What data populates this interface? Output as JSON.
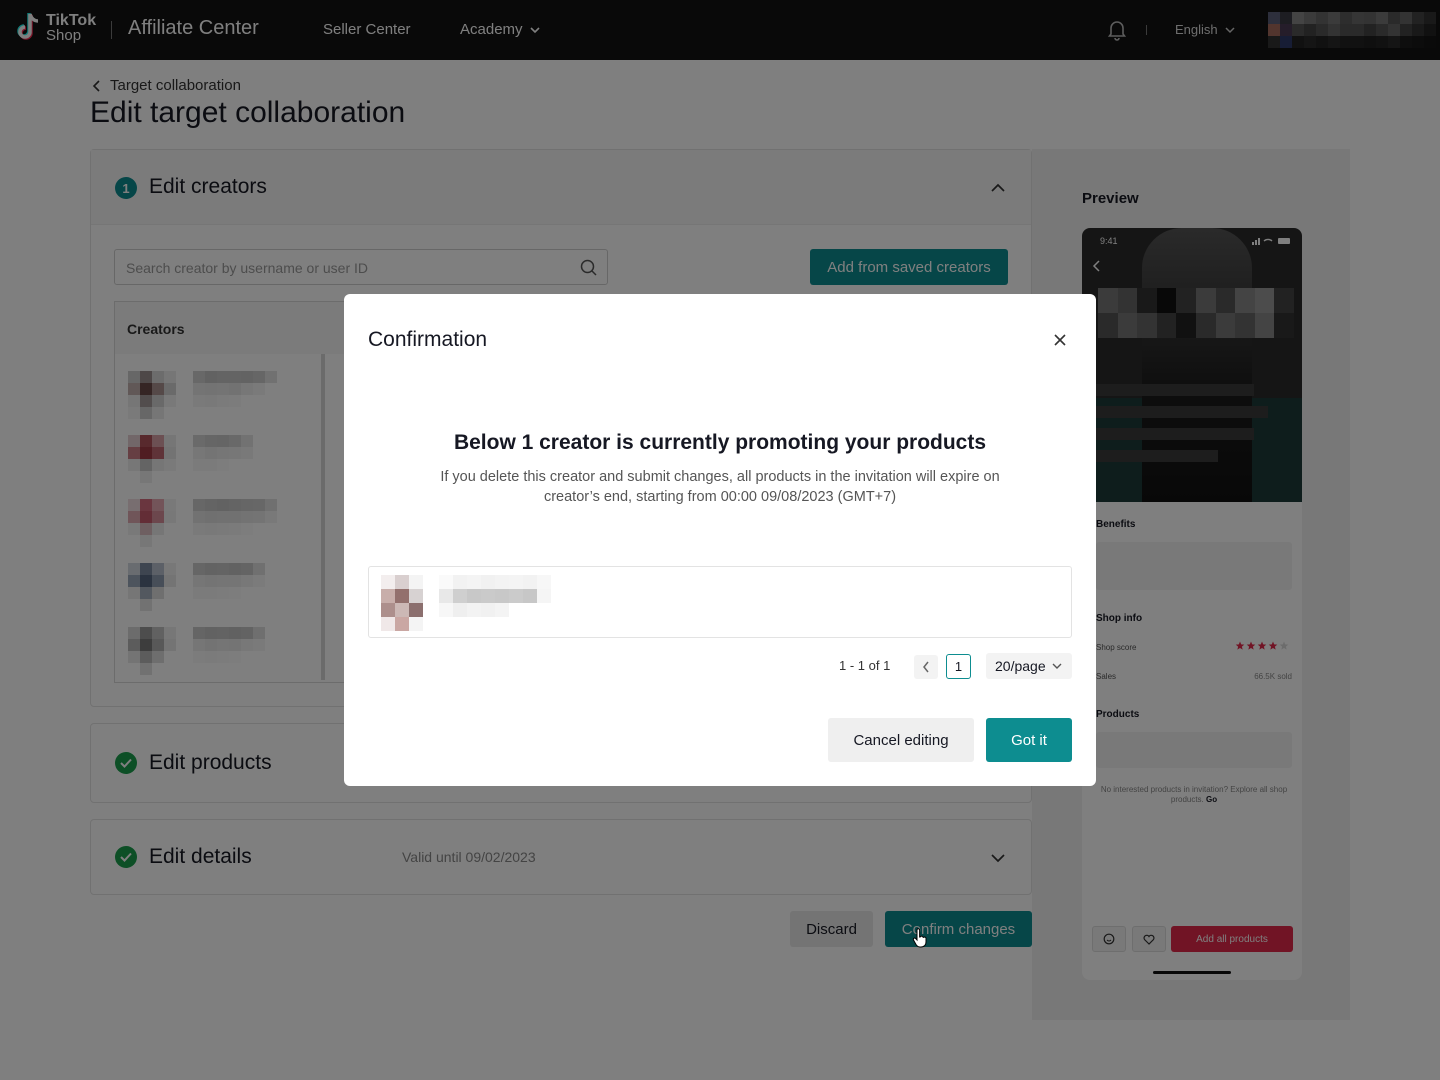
{
  "topbar": {
    "logo_line1": "TikTok",
    "logo_line2": "Shop",
    "app_title": "Affiliate Center",
    "nav_seller_center": "Seller Center",
    "nav_academy": "Academy",
    "language": "English",
    "icons": [
      "tiktok-logo",
      "chevron-down-icon",
      "bell-icon"
    ]
  },
  "page": {
    "breadcrumb": "Target collaboration",
    "title": "Edit target collaboration"
  },
  "sections": {
    "creators": {
      "step": "1",
      "title": "Edit creators",
      "search_placeholder": "Search creator by username or user ID",
      "add_saved_label": "Add from saved creators",
      "list_header": "Creators"
    },
    "products": {
      "title": "Edit products"
    },
    "details": {
      "title": "Edit details",
      "valid_until": "Valid until 09/02/2023"
    }
  },
  "footer": {
    "discard_label": "Discard",
    "confirm_label": "Confirm changes"
  },
  "preview": {
    "title": "Preview",
    "phone_time": "9:41",
    "benefits_label": "Benefits",
    "shop_info_label": "Shop info",
    "shop_score_label": "Shop score",
    "rating_stars": 4,
    "rating_max": 5,
    "sales_label": "Sales",
    "sales_value": "66.5K sold",
    "products_label": "Products",
    "no_products_text": "No interested products in invitation? Explore all shop products.",
    "go_link": "Go",
    "add_all_label": "Add all products"
  },
  "modal": {
    "title": "Confirmation",
    "heading": "Below 1 creator is currently promoting your products",
    "description": "If you delete this creator and submit changes, all products in the invitation will expire on creator’s end, starting from 00:00 09/08/2023 (GMT+7)",
    "pagination_text": "1 - 1 of 1",
    "current_page": "1",
    "page_size": "20/page",
    "cancel_label": "Cancel editing",
    "ok_label": "Got it"
  },
  "colors": {
    "accent": "#0d8d90",
    "success": "#1a9e4c",
    "brand_red": "#e2294a",
    "topbar_bg": "#121212"
  }
}
